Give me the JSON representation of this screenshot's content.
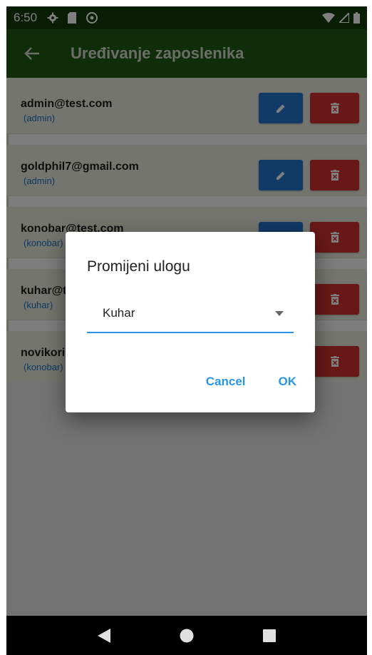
{
  "status_bar": {
    "time": "6:50"
  },
  "app_bar": {
    "title": "Uređivanje zaposlenika"
  },
  "employees": [
    {
      "email": "admin@test.com",
      "role": "(admin)"
    },
    {
      "email": "goldphil7@gmail.com",
      "role": "(admin)"
    },
    {
      "email": "konobar@test.com",
      "role": "(konobar)"
    },
    {
      "email": "kuhar@test.com",
      "role": "(kuhar)"
    },
    {
      "email": "novikorisnik@test.com",
      "role": "(konobar)"
    }
  ],
  "dialog": {
    "title": "Promijeni ulogu",
    "selected_role": "Kuhar",
    "cancel_label": "Cancel",
    "ok_label": "OK"
  },
  "colors": {
    "status_bar": "#143d0d",
    "app_bar": "#1e5a12",
    "edit_button": "#2374cf",
    "delete_button": "#d1322f",
    "accent": "#2a95e8"
  },
  "icons": {
    "back": "arrow-left-icon",
    "edit": "pencil-icon",
    "delete": "trash-icon",
    "dropdown": "caret-down-icon"
  }
}
